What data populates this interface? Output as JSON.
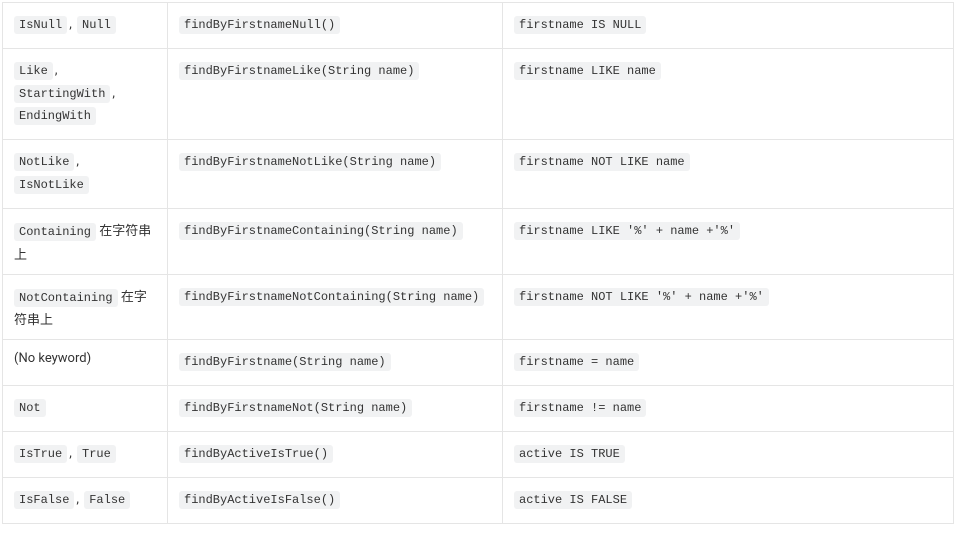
{
  "rows": [
    {
      "keywords": [
        "IsNull",
        "Null"
      ],
      "suffix": "",
      "sample": "findByFirstnameNull()",
      "snippet": "firstname IS NULL"
    },
    {
      "keywords": [
        "Like",
        "StartingWith",
        "EndingWith"
      ],
      "suffix": "",
      "sample": "findByFirstnameLike(String name)",
      "snippet": "firstname LIKE name"
    },
    {
      "keywords": [
        "NotLike",
        "IsNotLike"
      ],
      "suffix": "",
      "sample": "findByFirstnameNotLike(String name)",
      "snippet": "firstname NOT LIKE name"
    },
    {
      "keywords": [
        "Containing"
      ],
      "suffix": " 在字符串上",
      "sample": "findByFirstnameContaining(String name)",
      "snippet": "firstname LIKE '%' + name +'%'"
    },
    {
      "keywords": [
        "NotContaining"
      ],
      "suffix": " 在字符串上",
      "sample": "findByFirstnameNotContaining(String name)",
      "snippet": "firstname NOT LIKE '%' + name +'%'"
    },
    {
      "keywords_plain": "(No keyword)",
      "keywords": [],
      "suffix": "",
      "sample": "findByFirstname(String name)",
      "snippet": "firstname = name"
    },
    {
      "keywords": [
        "Not"
      ],
      "suffix": "",
      "sample": "findByFirstnameNot(String name)",
      "snippet": "firstname != name"
    },
    {
      "keywords": [
        "IsTrue",
        "True"
      ],
      "suffix": "",
      "sample": "findByActiveIsTrue()",
      "snippet": "active IS TRUE"
    },
    {
      "keywords": [
        "IsFalse",
        "False"
      ],
      "suffix": "",
      "sample": "findByActiveIsFalse()",
      "snippet": "active IS FALSE"
    }
  ]
}
